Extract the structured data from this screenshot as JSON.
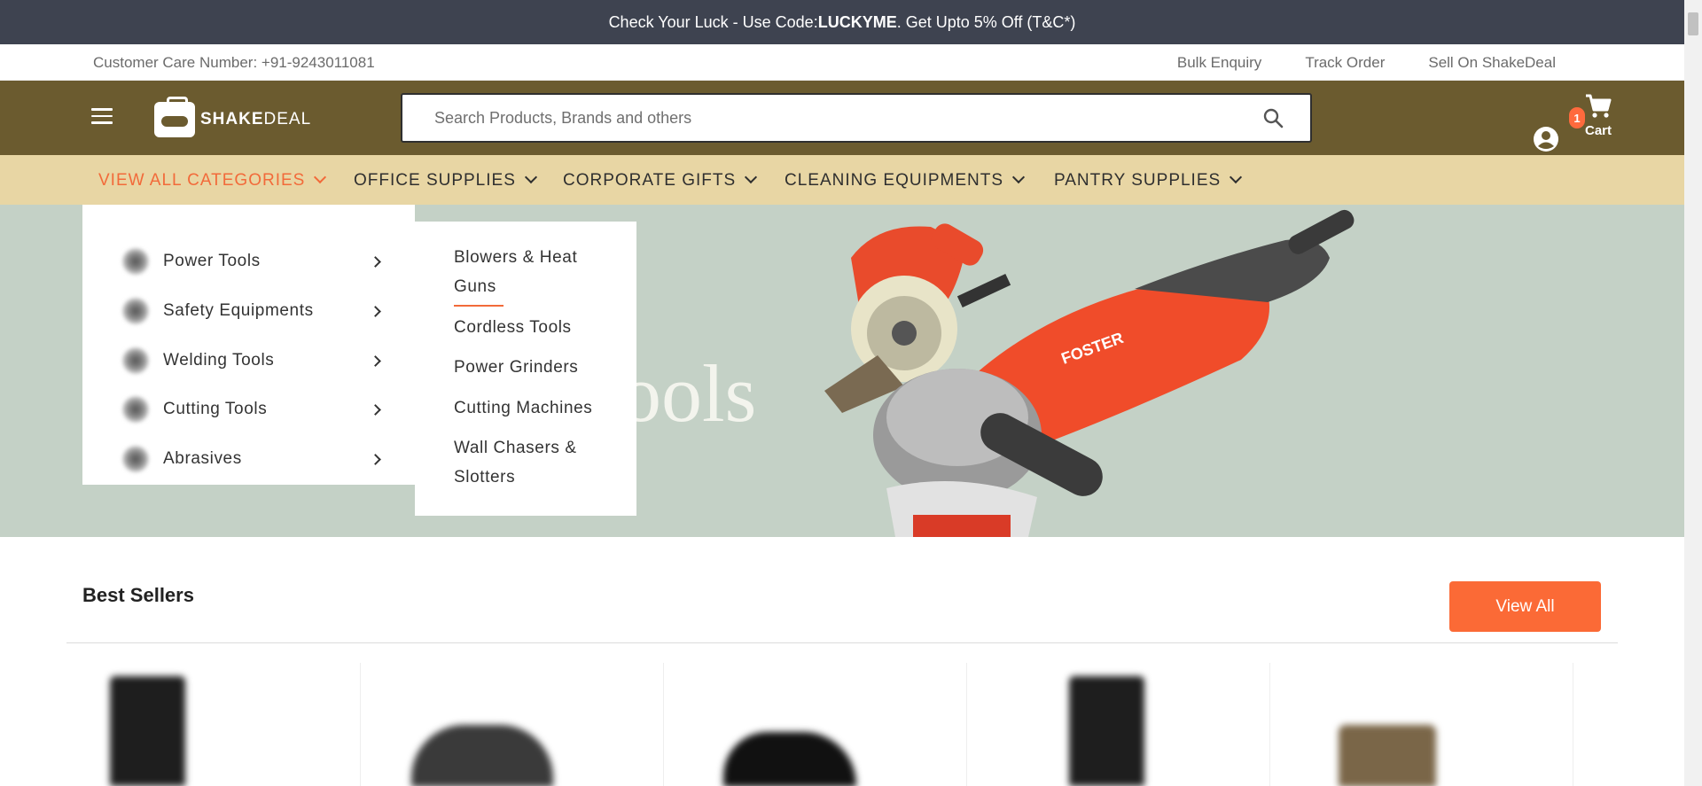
{
  "promo": {
    "prefix": "Check Your Luck - Use Code: ",
    "code": "LUCKYME",
    "suffix": ". Get Upto 5% Off (T&C*)"
  },
  "utility": {
    "customer_care": "Customer Care Number: +91-9243011081",
    "links": [
      "Bulk Enquiry",
      "Track Order",
      "Sell On ShakeDeal"
    ]
  },
  "header": {
    "logo_bold": "SHAKE",
    "logo_light": "DEAL",
    "search_placeholder": "Search Products, Brands and others",
    "cart_count": "1",
    "cart_label": "Cart"
  },
  "category_nav": [
    "VIEW ALL CATEGORIES",
    "OFFICE SUPPLIES",
    "CORPORATE GIFTS",
    "CLEANING EQUIPMENTS",
    "PANTRY SUPPLIES"
  ],
  "hero": {
    "partial_text": "ools"
  },
  "categories_menu": [
    "Power Tools",
    "Safety Equipments",
    "Welding Tools",
    "Cutting Tools",
    "Abrasives"
  ],
  "subcategories_menu": [
    "Blowers & Heat Guns",
    "Cordless Tools",
    "Power Grinders",
    "Cutting Machines",
    "Wall Chasers & Slotters"
  ],
  "best_sellers": {
    "title": "Best Sellers",
    "view_all_label": "View All"
  },
  "colors": {
    "promo_bg": "#3e4350",
    "header_bg": "#6b5b2f",
    "nav_bg": "#e8d6a4",
    "accent": "#f26a3a",
    "hero_bg": "#c4d1c6"
  }
}
